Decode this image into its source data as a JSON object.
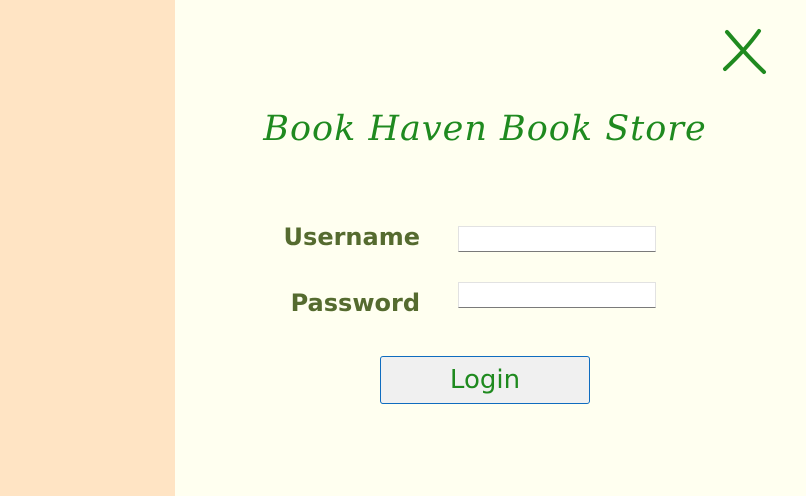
{
  "app": {
    "title": "Book Haven Book Store"
  },
  "colors": {
    "left_panel_background": "#ffe4c4",
    "main_background": "#fffff0",
    "title_text": "#1f8a1f",
    "label_text": "#556b2f",
    "button_border": "#0f6cbf",
    "button_background": "#f0f0f0"
  },
  "close": {
    "icon": "close-icon",
    "label": "X"
  },
  "form": {
    "username_label": "Username",
    "username_value": "",
    "password_label": "Password",
    "password_value": "",
    "login_label": "Login"
  }
}
